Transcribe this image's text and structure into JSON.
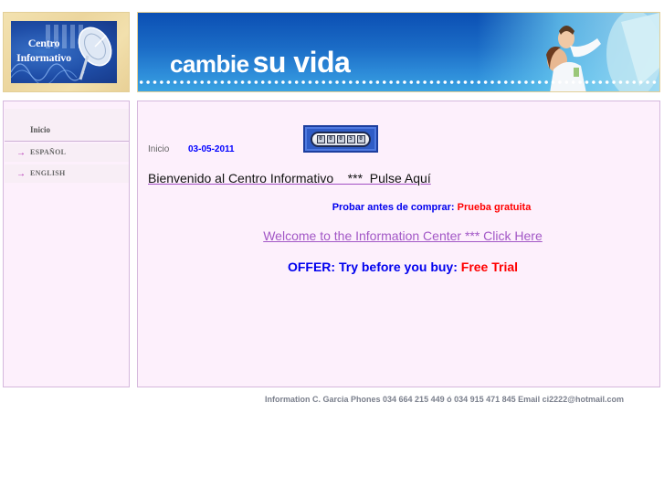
{
  "logo": {
    "line1": "Centro",
    "line2": "Informativo",
    "icon": "satellite-dish-icon"
  },
  "banner": {
    "word1": "cambie",
    "word2": "su vida",
    "image": "family-photo"
  },
  "sidebar": {
    "home_label": "Inicio",
    "items": [
      {
        "icon": "arrow-right-icon",
        "arrow": "→",
        "label": "ESPAÑOL"
      },
      {
        "icon": "arrow-right-icon",
        "arrow": "→",
        "label": "ENGLISH"
      }
    ]
  },
  "main": {
    "breadcrumb_home": "Inicio",
    "date": "03-05-2011",
    "counter": {
      "digits": [
        "0",
        "0",
        "0",
        "5",
        "0"
      ]
    },
    "welcome_es": "Bienvenido al Centro Informativo    ***  Pulse Aquí",
    "offer_es": {
      "prefix": "Probar antes de comprar: ",
      "link": "Prueba gratuita"
    },
    "welcome_en": "Welcome to the Information Center *** Click Here",
    "offer_en": {
      "prefix": "OFFER: Try before you buy: ",
      "link": "Free Trial"
    }
  },
  "footer": {
    "text": "Information C. Garcia Phones 034 664 215 449 ó 034 915 471 845 Email ci2222@hotmail.com"
  },
  "colors": {
    "panel_bg": "#fdf0fc",
    "panel_border": "#d5b8dd",
    "link_blue": "#0000ee",
    "link_red": "#ff0000",
    "link_purple": "#a257c6",
    "arrow_magenta": "#b02ab0"
  }
}
